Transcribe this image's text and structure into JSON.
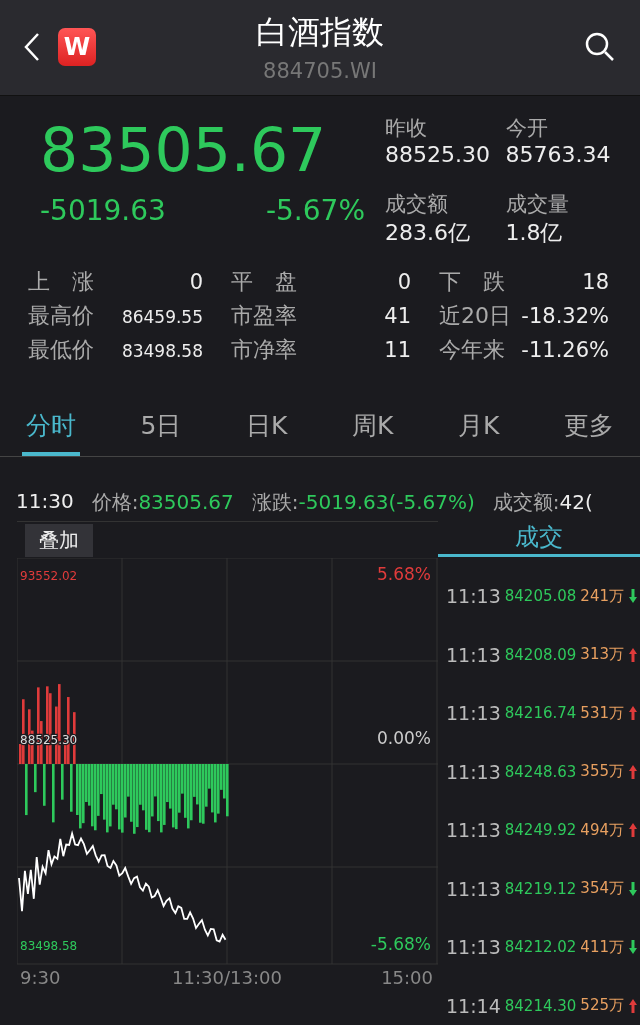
{
  "header": {
    "title": "白酒指数",
    "code": "884705.WI",
    "logo": "W"
  },
  "quote": {
    "price": "83505.67",
    "change": "-5019.63",
    "change_pct": "-5.67%"
  },
  "summary": [
    {
      "label": "昨收",
      "value": "88525.30"
    },
    {
      "label": "今开",
      "value": "85763.34"
    },
    {
      "label": "成交额",
      "value": "283.6亿"
    },
    {
      "label": "成交量",
      "value": "1.8亿"
    }
  ],
  "stats": [
    {
      "label": "上　涨",
      "value": "0",
      "kind": "plain"
    },
    {
      "label": "平　盘",
      "value": "0",
      "kind": "plain"
    },
    {
      "label": "下　跌",
      "value": "18",
      "kind": "plain"
    },
    {
      "label": "最高价",
      "value": "86459.55",
      "kind": "small"
    },
    {
      "label": "市盈率",
      "value": "41",
      "kind": "plain"
    },
    {
      "label": "近20日",
      "value": "-18.32%",
      "kind": "plain"
    },
    {
      "label": "最低价",
      "value": "83498.58",
      "kind": "small"
    },
    {
      "label": "市净率",
      "value": "11",
      "kind": "plain"
    },
    {
      "label": "今年来",
      "value": "-11.26%",
      "kind": "plain"
    }
  ],
  "tabs": [
    {
      "label": "分时",
      "selected": true
    },
    {
      "label": "5日",
      "selected": false
    },
    {
      "label": "日K",
      "selected": false
    },
    {
      "label": "周K",
      "selected": false
    },
    {
      "label": "月K",
      "selected": false
    },
    {
      "label": "更多",
      "selected": false
    }
  ],
  "info_bar": {
    "time": "11:30",
    "price_label": "价格:",
    "price": "83505.67",
    "change_label": "涨跌:",
    "change": "-5019.63(-5.67%)",
    "amount_label": "成交额:",
    "amount": "42("
  },
  "chart": {
    "overlay_button": "叠加",
    "high": "93552.02",
    "prev_close": "88525.30",
    "low": "83498.58",
    "pct_high": "5.68%",
    "pct_zero": "0.00%",
    "pct_low": "-5.68%",
    "times": [
      "9:30",
      "11:30/13:00",
      "15:00"
    ]
  },
  "trades": {
    "title": "成交",
    "rows": [
      {
        "time": "11:13",
        "price": "84205.08",
        "volume": "241万",
        "kind": "down"
      },
      {
        "time": "11:13",
        "price": "84208.09",
        "volume": "313万",
        "kind": "up"
      },
      {
        "time": "11:13",
        "price": "84216.74",
        "volume": "531万",
        "kind": "up"
      },
      {
        "time": "11:13",
        "price": "84248.63",
        "volume": "355万",
        "kind": "up"
      },
      {
        "time": "11:13",
        "price": "84249.92",
        "volume": "494万",
        "kind": "up"
      },
      {
        "time": "11:13",
        "price": "84219.12",
        "volume": "354万",
        "kind": "down"
      },
      {
        "time": "11:13",
        "price": "84212.02",
        "volume": "411万",
        "kind": "down"
      },
      {
        "time": "11:14",
        "price": "84214.30",
        "volume": "525万",
        "kind": "up"
      }
    ]
  }
}
